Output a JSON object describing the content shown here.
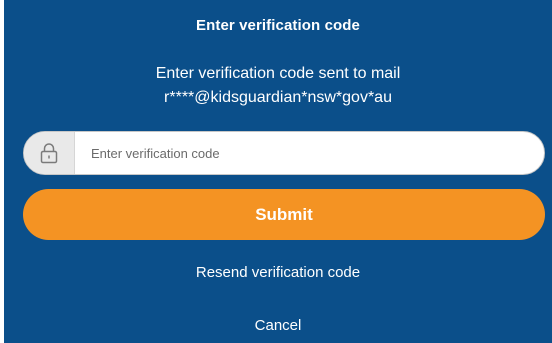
{
  "dialog": {
    "title": "Enter verification code",
    "subtitle_line1": "Enter verification code sent to mail",
    "subtitle_line2": "r****@kidsguardian*nsw*gov*au"
  },
  "code_field": {
    "icon": "lock-icon",
    "value": "",
    "placeholder": "Enter verification code"
  },
  "actions": {
    "submit_label": "Submit",
    "resend_label": "Resend verification code",
    "cancel_label": "Cancel"
  },
  "colors": {
    "panel_background": "#0b4f8a",
    "submit_button": "#f49323",
    "text": "#ffffff"
  }
}
